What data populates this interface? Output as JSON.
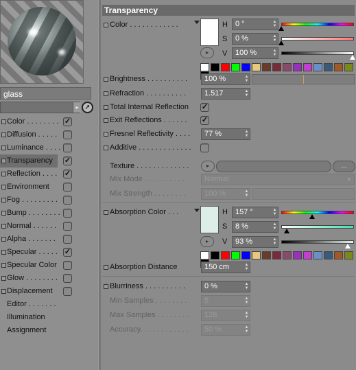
{
  "material_name": "glass",
  "channels": [
    {
      "label": "Color . . . . . . . .",
      "checked": true,
      "bullet": true,
      "selected": false
    },
    {
      "label": "Diffusion . . . . .",
      "checked": false,
      "bullet": true,
      "selected": false
    },
    {
      "label": "Luminance . . . .",
      "checked": false,
      "bullet": true,
      "selected": false
    },
    {
      "label": "Transparency",
      "checked": true,
      "bullet": true,
      "selected": true
    },
    {
      "label": "Reflection . . . .",
      "checked": true,
      "bullet": true,
      "selected": false
    },
    {
      "label": "Environment",
      "checked": false,
      "bullet": true,
      "selected": false
    },
    {
      "label": "Fog . . . . . . . . .",
      "checked": false,
      "bullet": true,
      "selected": false
    },
    {
      "label": "Bump . . . . . . . .",
      "checked": false,
      "bullet": true,
      "selected": false
    },
    {
      "label": "Normal . . . . . .",
      "checked": false,
      "bullet": true,
      "selected": false
    },
    {
      "label": "Alpha . . . . . . .",
      "checked": false,
      "bullet": true,
      "selected": false
    },
    {
      "label": "Specular . . . . .",
      "checked": true,
      "bullet": true,
      "selected": false
    },
    {
      "label": "Specular Color",
      "checked": false,
      "bullet": true,
      "selected": false
    },
    {
      "label": "Glow . . . . . . . .",
      "checked": false,
      "bullet": true,
      "selected": false
    },
    {
      "label": "Displacement",
      "checked": false,
      "bullet": true,
      "selected": false
    },
    {
      "label": "Editor . . . . . . .",
      "checked": null,
      "bullet": false,
      "selected": false
    },
    {
      "label": "Illumination",
      "checked": null,
      "bullet": false,
      "selected": false
    },
    {
      "label": "Assignment",
      "checked": null,
      "bullet": false,
      "selected": false
    }
  ],
  "section_title": "Transparency",
  "color": {
    "label": "Color . . . . . . . . . . . .",
    "h_label": "H",
    "h_value": "0 °",
    "s_label": "S",
    "s_value": "0 %",
    "v_label": "V",
    "v_value": "100 %",
    "swatch": "#ffffff",
    "h_level": 0.0,
    "s_level": 0.0,
    "v_level": 1.0
  },
  "brightness": {
    "label": "Brightness . . . . . . . . . .",
    "value": "100 %"
  },
  "refraction": {
    "label": "Refraction . . . . . . . . . .",
    "value": "1.517"
  },
  "total_internal_reflection": {
    "label": "Total Internal Reflection",
    "checked": true
  },
  "exit_reflections": {
    "label": "Exit Reflections . . . . . .",
    "checked": true
  },
  "fresnel": {
    "label": "Fresnel Reflectivity . . . .",
    "value": "77 %"
  },
  "additive": {
    "label": "Additive . . . . . . . . . . . . .",
    "checked": false
  },
  "texture": {
    "label": "Texture . . . . . . . . . . . . .",
    "button_label": "..."
  },
  "mix_mode": {
    "label": "Mix Mode . . . . . . . . . .",
    "value": "Normal"
  },
  "mix_strength": {
    "label": "Mix Strength . . . . . . . .",
    "value": "100 %"
  },
  "absorption": {
    "label": "Absorption Color . . .",
    "h_label": "H",
    "h_value": "157 °",
    "s_label": "S",
    "s_value": "8 %",
    "v_label": "V",
    "v_value": "93 %",
    "swatch": "#dceee7",
    "h_level": 0.436,
    "s_level": 0.08,
    "v_level": 0.93
  },
  "absorption_distance": {
    "label": "Absorption Distance",
    "value": "150 cm"
  },
  "blurriness": {
    "label": "Blurriness . . . . . . . . . .",
    "value": "0 %"
  },
  "min_samples": {
    "label": "Min Samples . . . . . . . .",
    "value": "5"
  },
  "max_samples": {
    "label": "Max Samples . . . . . . . .",
    "value": "128"
  },
  "accuracy": {
    "label": "Accuracy. . . . . . . . . . . .",
    "value": "50 %"
  },
  "swatch_colors": [
    "#ffffff",
    "#000000",
    "#ff0000",
    "#00ff00",
    "#0000ff",
    "#e8c87a",
    "#6b3a2a",
    "#7a2a3a",
    "#8a4a6a",
    "#9a30c0",
    "#c040d0",
    "#6a90c8",
    "#3a5a7a",
    "#a05a2a",
    "#7a8a1a",
    "#000000"
  ],
  "accent_select": "#6f6f6f"
}
